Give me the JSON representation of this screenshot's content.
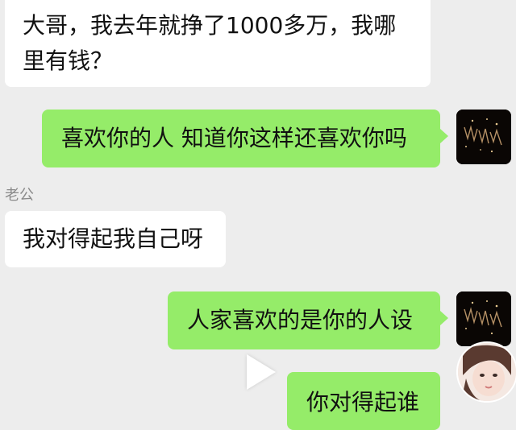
{
  "conversation": {
    "messages": [
      {
        "side": "left",
        "lines": [
          "大哥，我去年就挣了1000多万，我哪",
          "里有钱？"
        ]
      },
      {
        "side": "right",
        "text": "喜欢你的人 知道你这样还喜欢你吗"
      },
      {
        "side": "left",
        "sender": "老公",
        "text": "我对得起我自己呀"
      },
      {
        "side": "right",
        "text": "人家喜欢的是你的人设"
      },
      {
        "side": "right",
        "text": "你对得起谁"
      }
    ]
  },
  "icons": {
    "self_avatar": "fireworks-avatar",
    "other_avatar": "girl-avatar",
    "video_overlay": "play-icon"
  },
  "colors": {
    "background": "#ededed",
    "bubble_self": "#95ec69",
    "bubble_other": "#ffffff"
  }
}
